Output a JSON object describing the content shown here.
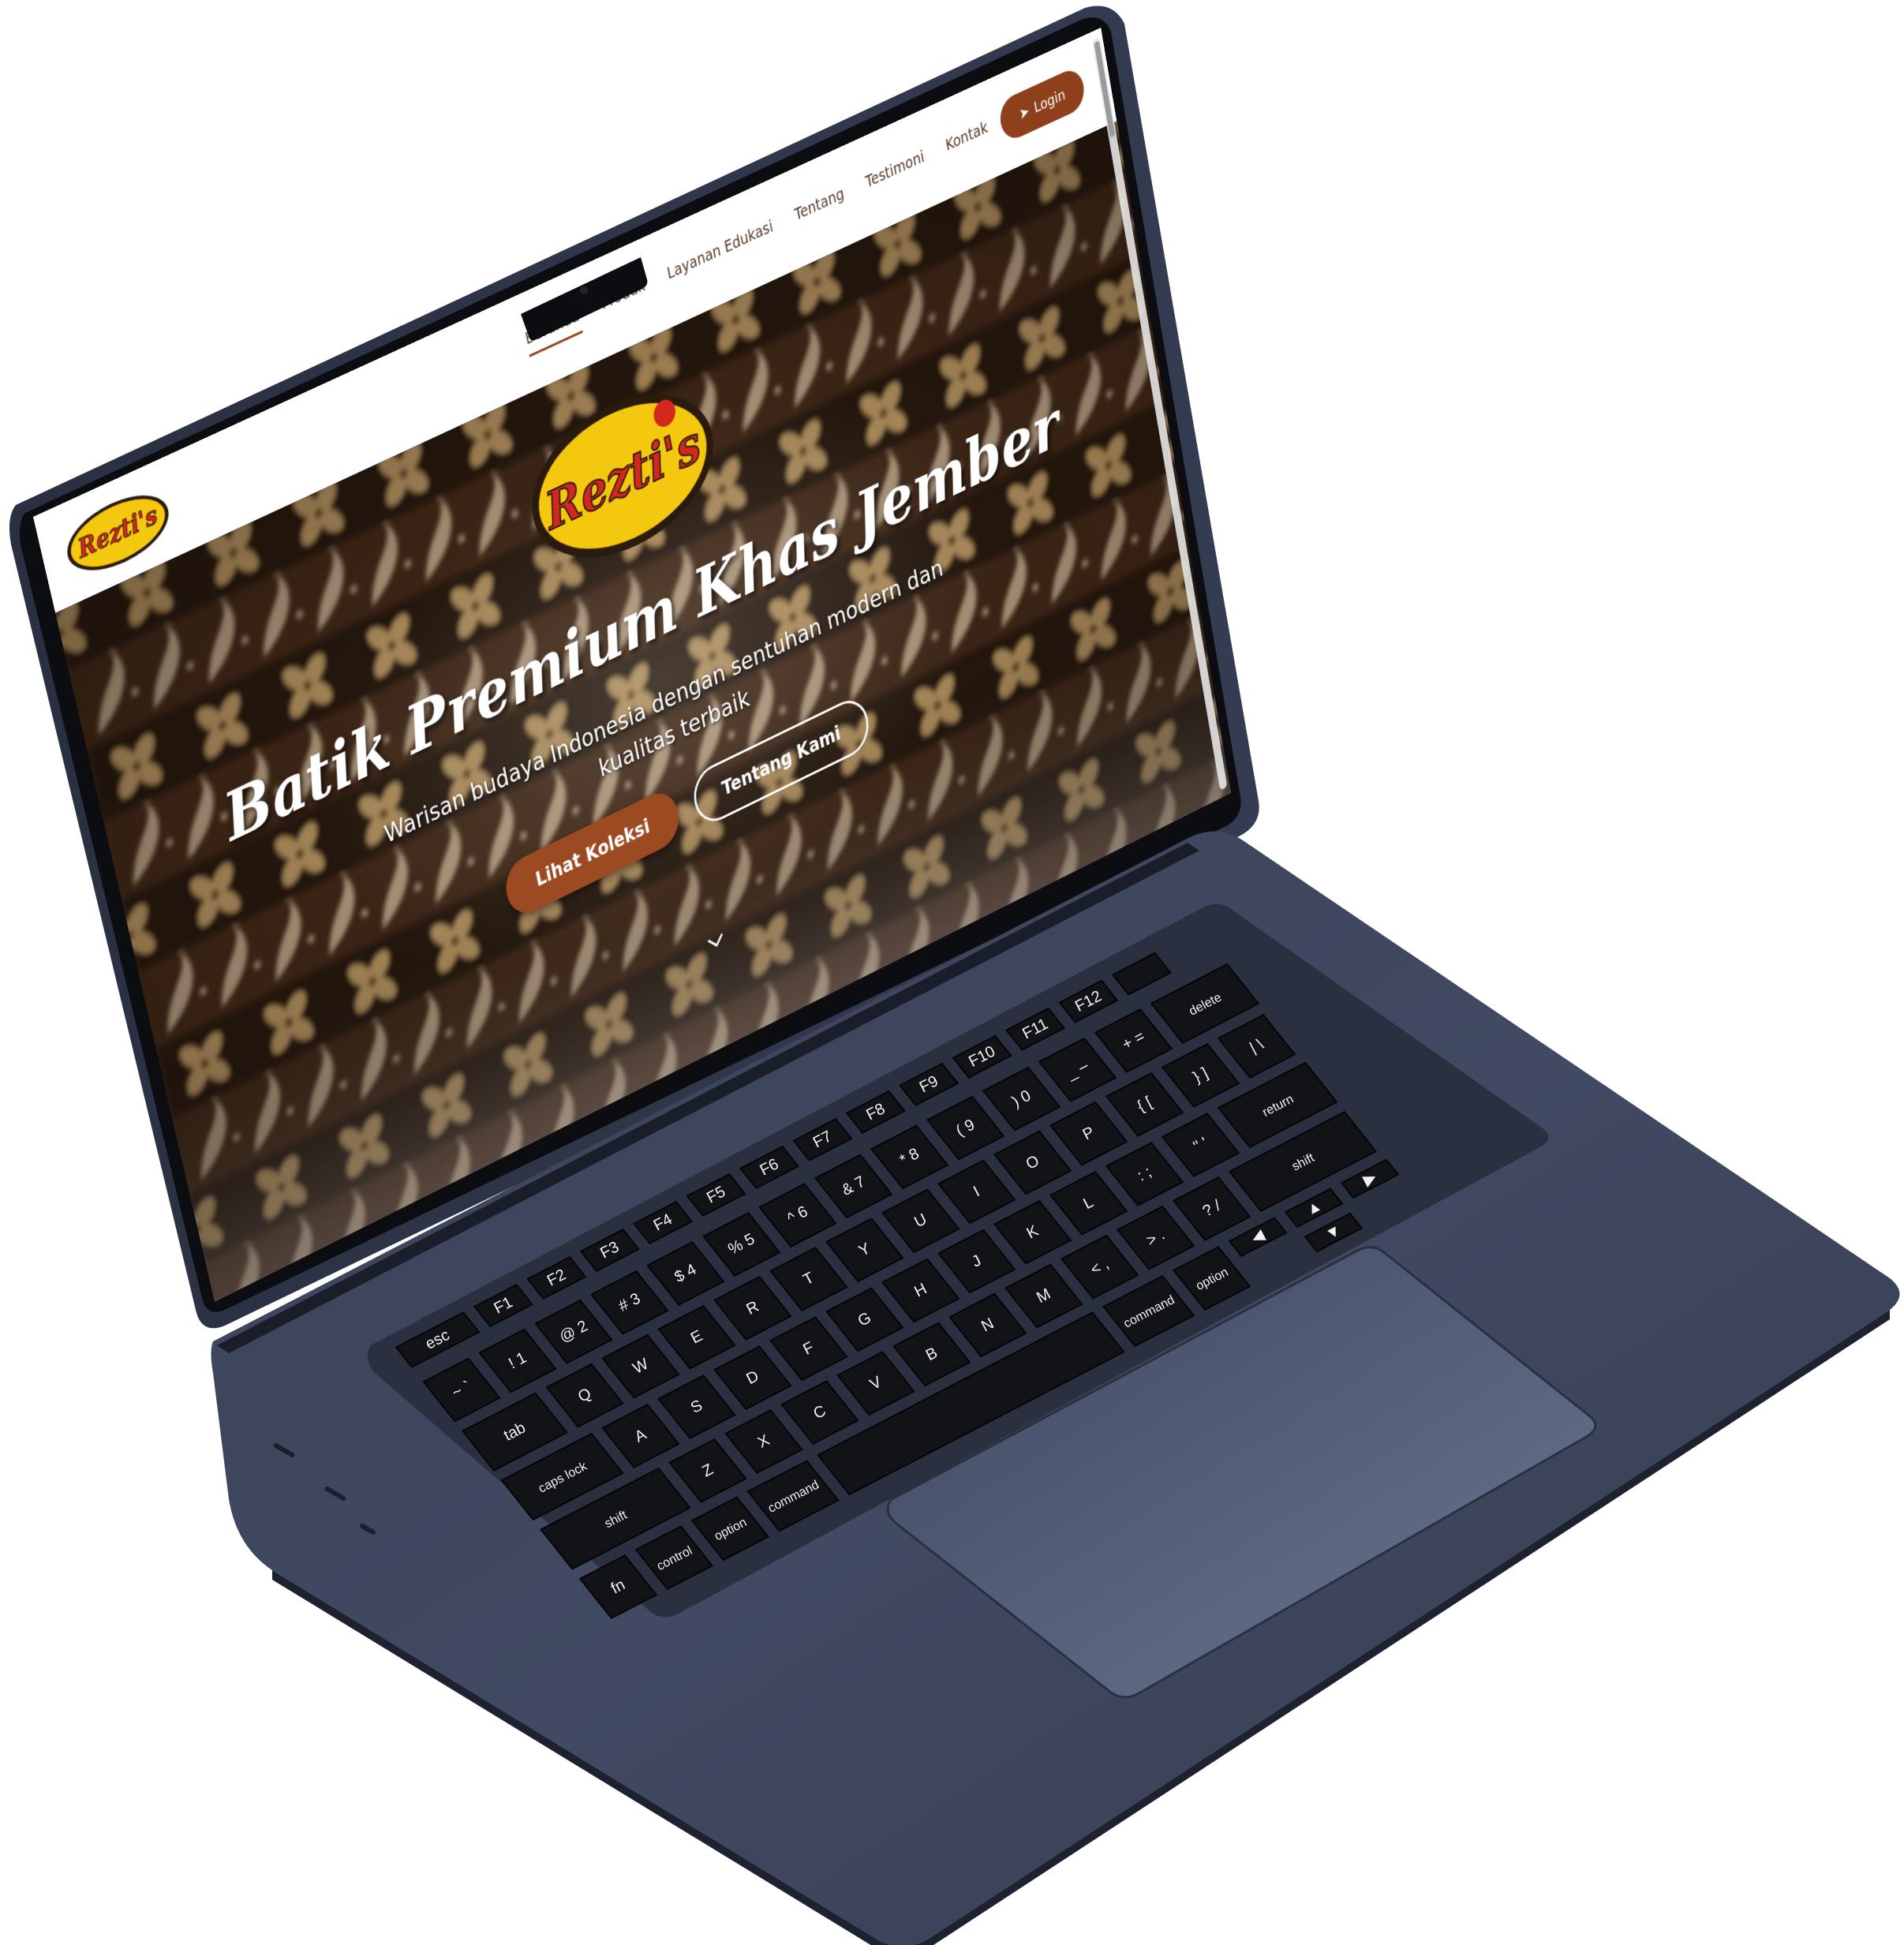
{
  "site": {
    "brand": "Rezti's",
    "nav": [
      {
        "label": "Beranda",
        "active": true
      },
      {
        "label": "Produk",
        "active": false
      },
      {
        "label": "Layanan Edukasi",
        "active": false
      },
      {
        "label": "Tentang",
        "active": false
      },
      {
        "label": "Testimoni",
        "active": false
      },
      {
        "label": "Kontak",
        "active": false
      }
    ],
    "login_label": "Login",
    "hero": {
      "title": "Batik Premium Khas Jember",
      "subtitle": "Warisan budaya Indonesia dengan sentuhan modern dan kualitas terbaik",
      "primary_button": "Lihat Koleksi",
      "secondary_button": "Tentang Kami"
    },
    "colors": {
      "accent": "#9b4a22",
      "batik_dark": "#2a1a10",
      "batik_gold": "#a8895a",
      "logo_yellow": "#f4c80e",
      "logo_red": "#d2281e"
    }
  },
  "keyboard": {
    "function_row": [
      "esc",
      "F1",
      "F2",
      "F3",
      "F4",
      "F5",
      "F6",
      "F7",
      "F8",
      "F9",
      "F10",
      "F11",
      "F12"
    ],
    "number_row": [
      {
        "top": "~",
        "bottom": "`"
      },
      {
        "top": "!",
        "bottom": "1"
      },
      {
        "top": "@",
        "bottom": "2"
      },
      {
        "top": "#",
        "bottom": "3"
      },
      {
        "top": "$",
        "bottom": "4"
      },
      {
        "top": "%",
        "bottom": "5"
      },
      {
        "top": "^",
        "bottom": "6"
      },
      {
        "top": "&",
        "bottom": "7"
      },
      {
        "top": "*",
        "bottom": "8"
      },
      {
        "top": "(",
        "bottom": "9"
      },
      {
        "top": ")",
        "bottom": "0"
      },
      {
        "top": "_",
        "bottom": "–"
      },
      {
        "top": "+",
        "bottom": "="
      }
    ],
    "delete_label": "delete",
    "tab_label": "tab",
    "qwerty_row": [
      "Q",
      "W",
      "E",
      "R",
      "T",
      "Y",
      "U",
      "I",
      "O",
      "P",
      "{ [",
      "} ]",
      "| \\"
    ],
    "caps_label": "caps lock",
    "home_row": [
      "A",
      "S",
      "D",
      "F",
      "G",
      "H",
      "J",
      "K",
      "L",
      ": ;",
      "\" '"
    ],
    "return_label": "return",
    "shift_label": "shift",
    "bottom_letters": [
      "Z",
      "X",
      "C",
      "V",
      "B",
      "N",
      "M",
      "< ,",
      "> .",
      "? /"
    ],
    "modifiers": {
      "fn": "fn",
      "control": "control",
      "option": "option",
      "command": "command"
    }
  }
}
